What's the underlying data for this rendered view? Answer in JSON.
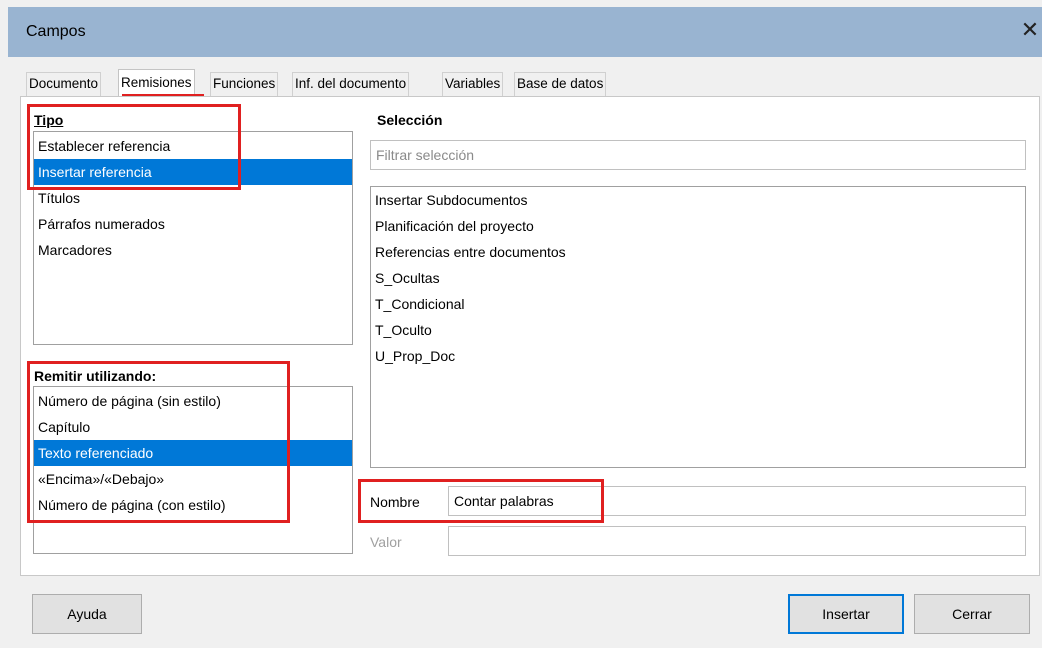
{
  "window": {
    "title": "Campos"
  },
  "tabs": [
    "Documento",
    "Remisiones",
    "Funciones",
    "Inf. del documento",
    "Variables",
    "Base de datos"
  ],
  "tipo": {
    "label": "Tipo",
    "items": [
      "Establecer referencia",
      "Insertar referencia",
      "Títulos",
      "Párrafos numerados",
      "Marcadores"
    ],
    "selected": "Insertar referencia"
  },
  "remitir": {
    "label": "Remitir utilizando:",
    "items": [
      "Número de página (sin estilo)",
      "Capítulo",
      "Texto referenciado",
      "«Encima»/«Debajo»",
      "Número de página (con estilo)"
    ],
    "selected": "Texto referenciado"
  },
  "seleccion": {
    "label": "Selección",
    "filter_placeholder": "Filtrar selección",
    "items": [
      "Insertar Subdocumentos",
      "Planificación del proyecto",
      "Referencias entre documentos",
      "S_Ocultas",
      "T_Condicional",
      "T_Oculto",
      "U_Prop_Doc"
    ]
  },
  "nombre": {
    "label": "Nombre",
    "value": "Contar palabras"
  },
  "valor": {
    "label": "Valor",
    "value": ""
  },
  "buttons": {
    "help": "Ayuda",
    "insert": "Insertar",
    "close": "Cerrar"
  },
  "colors": {
    "highlight": "#e02020",
    "selection": "#0078d7",
    "titlebar": "#99b4d1"
  }
}
